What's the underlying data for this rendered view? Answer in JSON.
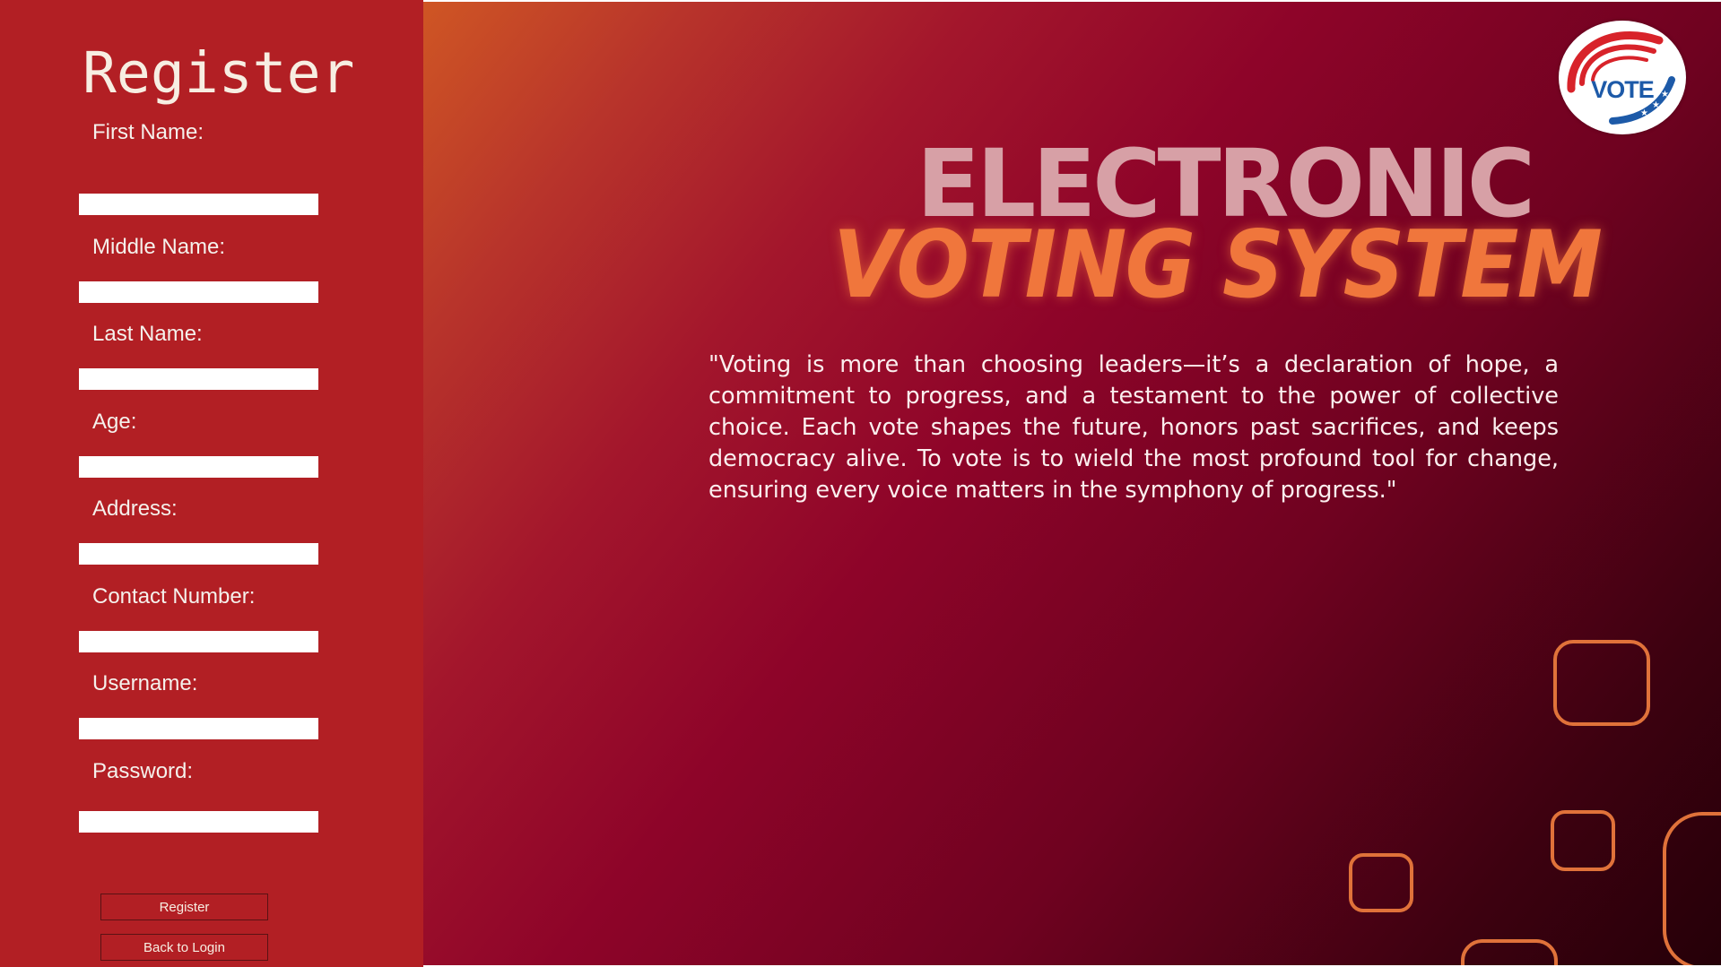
{
  "register_panel": {
    "title": "Register",
    "fields": [
      {
        "label": "First Name:",
        "value": ""
      },
      {
        "label": "Middle Name:",
        "value": ""
      },
      {
        "label": "Last Name:",
        "value": ""
      },
      {
        "label": "Age:",
        "value": ""
      },
      {
        "label": "Address:",
        "value": ""
      },
      {
        "label": "Contact Number:",
        "value": ""
      },
      {
        "label": "Username:",
        "value": ""
      },
      {
        "label": "Password:",
        "value": ""
      }
    ],
    "register_button": "Register",
    "back_button": "Back to Login"
  },
  "hero": {
    "logo_text": "VOTE",
    "headline_top": "ELECTRONIC",
    "headline_bottom": "VOTING SYSTEM",
    "quote": "\"Voting is more than choosing leaders—it’s a declaration of hope, a commitment to progress, and a testament to the power of collective choice. Each vote shapes the future, honors past sacrifices, and keeps democracy alive. To vote is to wield the most profound tool for change, ensuring every voice matters in the symphony of progress.\""
  },
  "colors": {
    "sidebar_bg": "#b21f24",
    "headline_top": "#d7a0a6",
    "headline_bottom": "#f0763c",
    "accent_outline": "#e0723a",
    "logo_blue": "#1d5aa8",
    "logo_red": "#d8232a"
  }
}
